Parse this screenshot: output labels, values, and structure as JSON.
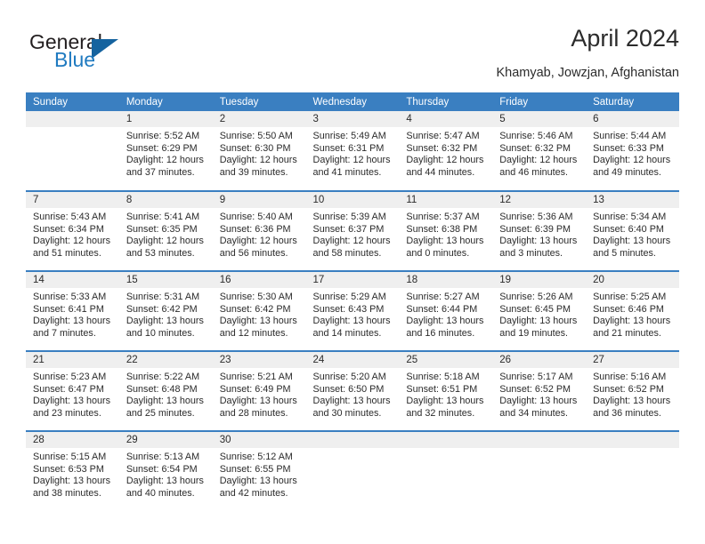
{
  "brand": {
    "name_part1": "General",
    "name_part2": "Blue",
    "triangle_color": "#15639f",
    "blue_color": "#1f7ac0"
  },
  "header": {
    "title": "April 2024",
    "subtitle": "Khamyab, Jowzjan, Afghanistan",
    "header_bg": "#3a7fc1",
    "daynum_bg": "#efefef"
  },
  "weekday_headers": [
    "Sunday",
    "Monday",
    "Tuesday",
    "Wednesday",
    "Thursday",
    "Friday",
    "Saturday"
  ],
  "weeks": [
    [
      {
        "day": "",
        "lines": []
      },
      {
        "day": "1",
        "lines": [
          "Sunrise: 5:52 AM",
          "Sunset: 6:29 PM",
          "Daylight: 12 hours",
          "and 37 minutes."
        ]
      },
      {
        "day": "2",
        "lines": [
          "Sunrise: 5:50 AM",
          "Sunset: 6:30 PM",
          "Daylight: 12 hours",
          "and 39 minutes."
        ]
      },
      {
        "day": "3",
        "lines": [
          "Sunrise: 5:49 AM",
          "Sunset: 6:31 PM",
          "Daylight: 12 hours",
          "and 41 minutes."
        ]
      },
      {
        "day": "4",
        "lines": [
          "Sunrise: 5:47 AM",
          "Sunset: 6:32 PM",
          "Daylight: 12 hours",
          "and 44 minutes."
        ]
      },
      {
        "day": "5",
        "lines": [
          "Sunrise: 5:46 AM",
          "Sunset: 6:32 PM",
          "Daylight: 12 hours",
          "and 46 minutes."
        ]
      },
      {
        "day": "6",
        "lines": [
          "Sunrise: 5:44 AM",
          "Sunset: 6:33 PM",
          "Daylight: 12 hours",
          "and 49 minutes."
        ]
      }
    ],
    [
      {
        "day": "7",
        "lines": [
          "Sunrise: 5:43 AM",
          "Sunset: 6:34 PM",
          "Daylight: 12 hours",
          "and 51 minutes."
        ]
      },
      {
        "day": "8",
        "lines": [
          "Sunrise: 5:41 AM",
          "Sunset: 6:35 PM",
          "Daylight: 12 hours",
          "and 53 minutes."
        ]
      },
      {
        "day": "9",
        "lines": [
          "Sunrise: 5:40 AM",
          "Sunset: 6:36 PM",
          "Daylight: 12 hours",
          "and 56 minutes."
        ]
      },
      {
        "day": "10",
        "lines": [
          "Sunrise: 5:39 AM",
          "Sunset: 6:37 PM",
          "Daylight: 12 hours",
          "and 58 minutes."
        ]
      },
      {
        "day": "11",
        "lines": [
          "Sunrise: 5:37 AM",
          "Sunset: 6:38 PM",
          "Daylight: 13 hours",
          "and 0 minutes."
        ]
      },
      {
        "day": "12",
        "lines": [
          "Sunrise: 5:36 AM",
          "Sunset: 6:39 PM",
          "Daylight: 13 hours",
          "and 3 minutes."
        ]
      },
      {
        "day": "13",
        "lines": [
          "Sunrise: 5:34 AM",
          "Sunset: 6:40 PM",
          "Daylight: 13 hours",
          "and 5 minutes."
        ]
      }
    ],
    [
      {
        "day": "14",
        "lines": [
          "Sunrise: 5:33 AM",
          "Sunset: 6:41 PM",
          "Daylight: 13 hours",
          "and 7 minutes."
        ]
      },
      {
        "day": "15",
        "lines": [
          "Sunrise: 5:31 AM",
          "Sunset: 6:42 PM",
          "Daylight: 13 hours",
          "and 10 minutes."
        ]
      },
      {
        "day": "16",
        "lines": [
          "Sunrise: 5:30 AM",
          "Sunset: 6:42 PM",
          "Daylight: 13 hours",
          "and 12 minutes."
        ]
      },
      {
        "day": "17",
        "lines": [
          "Sunrise: 5:29 AM",
          "Sunset: 6:43 PM",
          "Daylight: 13 hours",
          "and 14 minutes."
        ]
      },
      {
        "day": "18",
        "lines": [
          "Sunrise: 5:27 AM",
          "Sunset: 6:44 PM",
          "Daylight: 13 hours",
          "and 16 minutes."
        ]
      },
      {
        "day": "19",
        "lines": [
          "Sunrise: 5:26 AM",
          "Sunset: 6:45 PM",
          "Daylight: 13 hours",
          "and 19 minutes."
        ]
      },
      {
        "day": "20",
        "lines": [
          "Sunrise: 5:25 AM",
          "Sunset: 6:46 PM",
          "Daylight: 13 hours",
          "and 21 minutes."
        ]
      }
    ],
    [
      {
        "day": "21",
        "lines": [
          "Sunrise: 5:23 AM",
          "Sunset: 6:47 PM",
          "Daylight: 13 hours",
          "and 23 minutes."
        ]
      },
      {
        "day": "22",
        "lines": [
          "Sunrise: 5:22 AM",
          "Sunset: 6:48 PM",
          "Daylight: 13 hours",
          "and 25 minutes."
        ]
      },
      {
        "day": "23",
        "lines": [
          "Sunrise: 5:21 AM",
          "Sunset: 6:49 PM",
          "Daylight: 13 hours",
          "and 28 minutes."
        ]
      },
      {
        "day": "24",
        "lines": [
          "Sunrise: 5:20 AM",
          "Sunset: 6:50 PM",
          "Daylight: 13 hours",
          "and 30 minutes."
        ]
      },
      {
        "day": "25",
        "lines": [
          "Sunrise: 5:18 AM",
          "Sunset: 6:51 PM",
          "Daylight: 13 hours",
          "and 32 minutes."
        ]
      },
      {
        "day": "26",
        "lines": [
          "Sunrise: 5:17 AM",
          "Sunset: 6:52 PM",
          "Daylight: 13 hours",
          "and 34 minutes."
        ]
      },
      {
        "day": "27",
        "lines": [
          "Sunrise: 5:16 AM",
          "Sunset: 6:52 PM",
          "Daylight: 13 hours",
          "and 36 minutes."
        ]
      }
    ],
    [
      {
        "day": "28",
        "lines": [
          "Sunrise: 5:15 AM",
          "Sunset: 6:53 PM",
          "Daylight: 13 hours",
          "and 38 minutes."
        ]
      },
      {
        "day": "29",
        "lines": [
          "Sunrise: 5:13 AM",
          "Sunset: 6:54 PM",
          "Daylight: 13 hours",
          "and 40 minutes."
        ]
      },
      {
        "day": "30",
        "lines": [
          "Sunrise: 5:12 AM",
          "Sunset: 6:55 PM",
          "Daylight: 13 hours",
          "and 42 minutes."
        ]
      },
      {
        "day": "",
        "lines": []
      },
      {
        "day": "",
        "lines": []
      },
      {
        "day": "",
        "lines": []
      },
      {
        "day": "",
        "lines": []
      }
    ]
  ]
}
